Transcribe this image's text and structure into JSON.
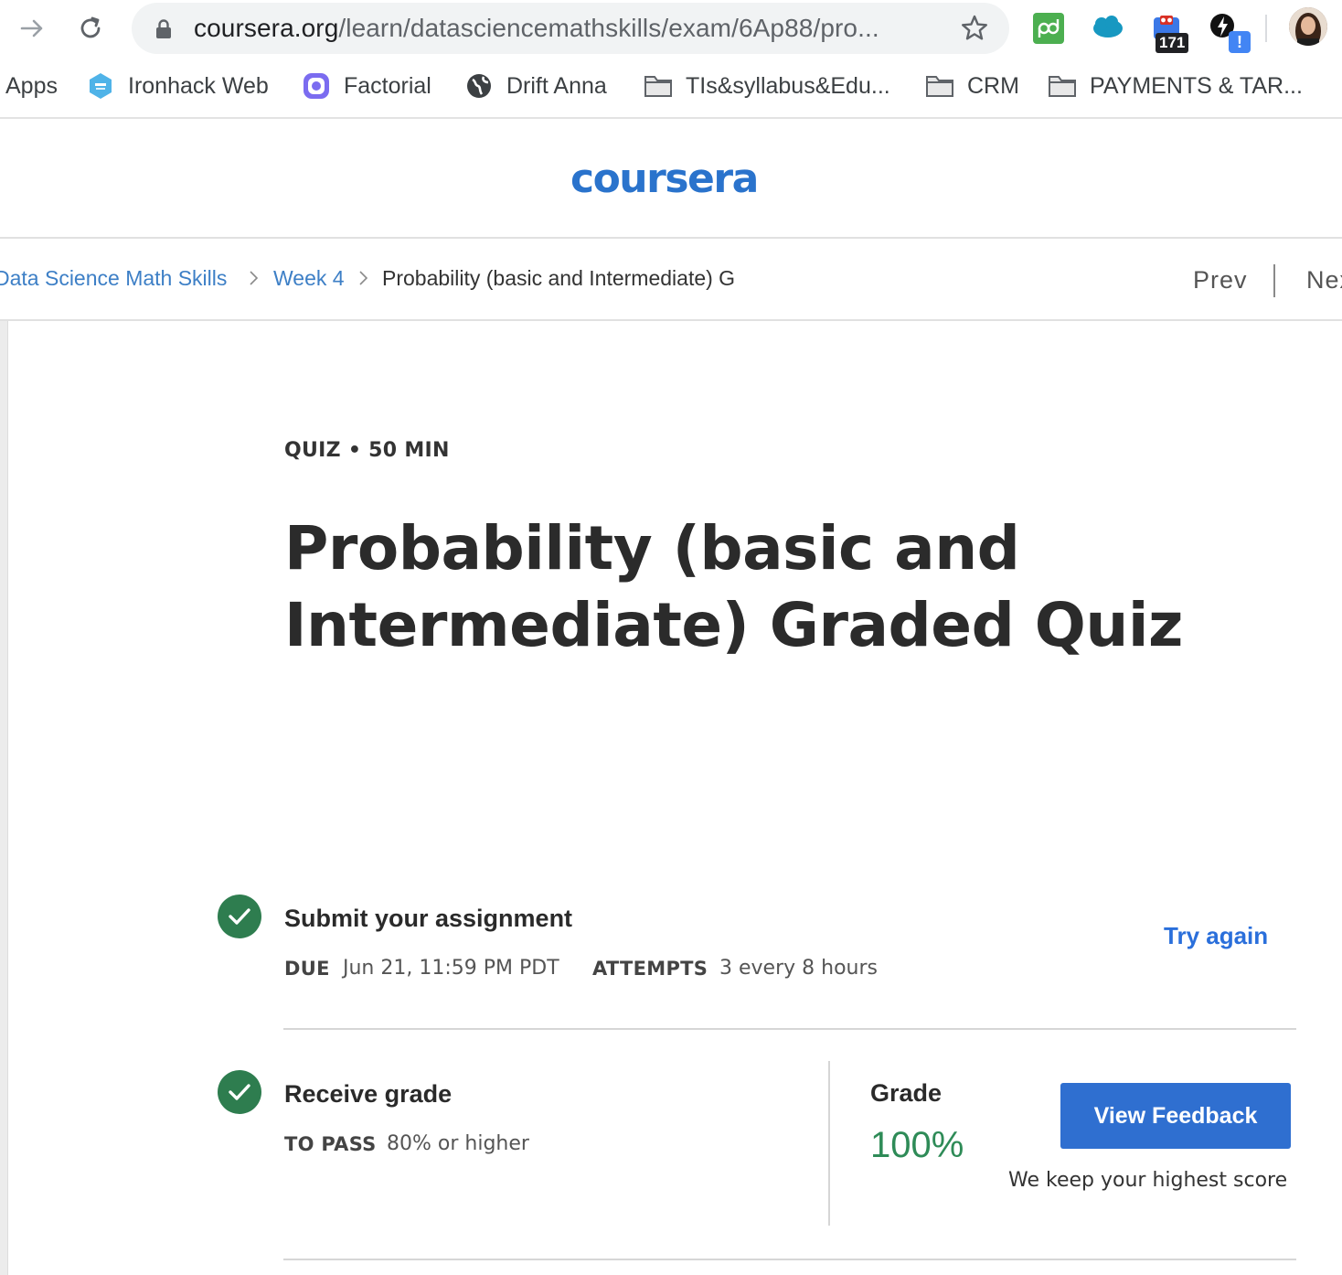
{
  "browser": {
    "url_host": "coursera.org",
    "url_path": "/learn/datasciencemathskills/exam/6Ap88/pro...",
    "extension_badge_count": "171",
    "extension_alert": "!"
  },
  "bookmarks": [
    {
      "label": "Apps",
      "icon": "apps-grid-icon"
    },
    {
      "label": "Ironhack Web",
      "icon": "ironhack-icon"
    },
    {
      "label": "Factorial",
      "icon": "factorial-icon"
    },
    {
      "label": "Drift Anna",
      "icon": "globe-icon"
    },
    {
      "label": "TIs&syllabus&Edu...",
      "icon": "folder-icon"
    },
    {
      "label": "CRM",
      "icon": "folder-icon"
    },
    {
      "label": "PAYMENTS & TAR...",
      "icon": "folder-icon"
    }
  ],
  "site": {
    "logo_text": "coursera",
    "brand_color": "#2a73cc"
  },
  "breadcrumb": {
    "items": [
      "Data Science Math Skills",
      "Week 4",
      "Probability (basic and Intermediate) G"
    ],
    "prev": "Prev",
    "next": "Nex"
  },
  "quiz": {
    "meta": "QUIZ • 50 MIN",
    "title": "Probability (basic and Intermediate) Graded Quiz"
  },
  "submit": {
    "title": "Submit your assignment",
    "due_label": "DUE",
    "due_value": "Jun 21, 11:59 PM PDT",
    "attempts_label": "ATTEMPTS",
    "attempts_value": "3 every 8 hours",
    "try_again": "Try again"
  },
  "grade": {
    "title": "Receive grade",
    "to_pass_label": "TO PASS",
    "to_pass_value": "80% or higher",
    "grade_label": "Grade",
    "grade_value": "100%",
    "view_feedback": "View Feedback",
    "keep_note": "We keep your highest score",
    "success_color": "#2e7d4f"
  }
}
